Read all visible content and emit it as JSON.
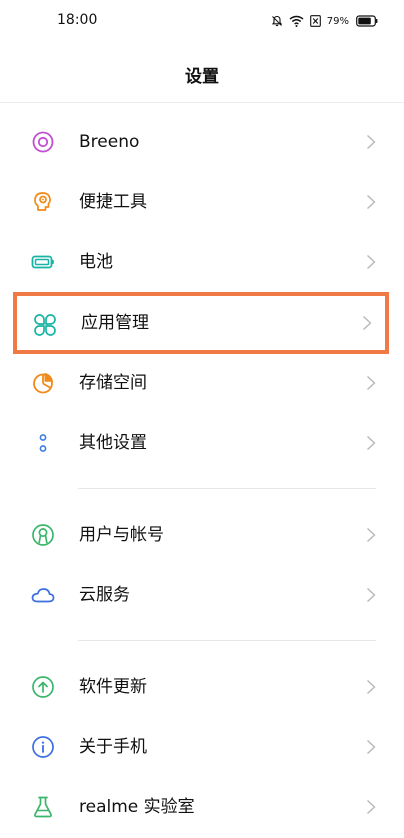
{
  "status_bar": {
    "time": "18:00",
    "battery": "79%"
  },
  "header": {
    "title": "设置"
  },
  "settings": {
    "items": [
      {
        "label": "Breeno",
        "icon": "breeno-icon",
        "color": "#c24fd1"
      },
      {
        "label": "便捷工具",
        "icon": "convenience-tools-icon",
        "color": "#f08a18"
      },
      {
        "label": "电池",
        "icon": "battery-icon",
        "color": "#19b3a3"
      },
      {
        "label": "应用管理",
        "icon": "app-management-icon",
        "color": "#19b3a3"
      },
      {
        "label": "存储空间",
        "icon": "storage-icon",
        "color": "#f08a18"
      },
      {
        "label": "其他设置",
        "icon": "other-settings-icon",
        "color": "#3b7de0"
      },
      {
        "label": "用户与帐号",
        "icon": "user-account-icon",
        "color": "#3bb56b"
      },
      {
        "label": "云服务",
        "icon": "cloud-icon",
        "color": "#3b6ee0"
      },
      {
        "label": "软件更新",
        "icon": "software-update-icon",
        "color": "#3bb56b"
      },
      {
        "label": "关于手机",
        "icon": "about-phone-icon",
        "color": "#3b6ee0"
      },
      {
        "label": "realme 实验室",
        "icon": "lab-flask-icon",
        "color": "#3bb56b"
      }
    ]
  },
  "highlight_color": "#f07a45"
}
